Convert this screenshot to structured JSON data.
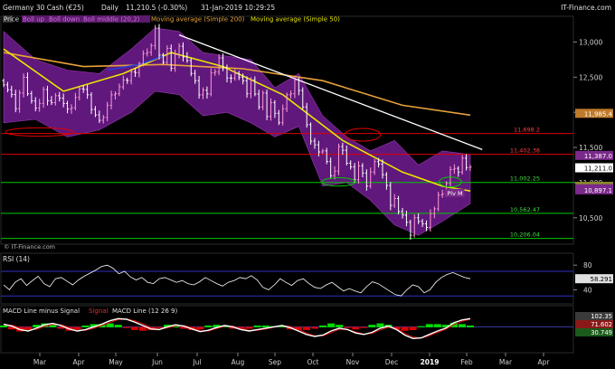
{
  "header": {
    "instrument": "Germany 30 Cash (€25)",
    "timeframe": "Daily",
    "quote": "11,210.5 (-0.30%)",
    "datetime": "31-Jan-2019 10:29:25",
    "brand": "IT-Finance.com"
  },
  "watermark": "© IT-Finance.com",
  "colors": {
    "bg": "#000000",
    "price_up": "#ff9ad5",
    "price_down": "#ffffff",
    "boll_fill": "#6a1b8a",
    "ma200": "#e8a23a",
    "ma50": "#e6e600",
    "ma_blue": "#2a3cd8",
    "trendline": "#ffffff",
    "resistance": "#e00000",
    "support": "#00cc00",
    "ellipse_red": "#e00000",
    "ellipse_green": "#00cc00",
    "rsi_line": "#ffffff",
    "rsi_band": "#3030c0",
    "macd_line": "#ffffff",
    "signal_line": "#e00000",
    "hist_pos": "#00dd00",
    "hist_neg": "#dd0000",
    "axis_text": "#cfcfcf"
  },
  "chart_data": [
    {
      "type": "candlestick",
      "panel": "price",
      "legend": [
        "Price",
        "Boll up",
        "Boll down",
        "Boll middle (20,2)",
        "Moving average (Simple 200)",
        "Moving average (Simple 50)"
      ],
      "xlabels": [
        "Mar",
        "Apr",
        "May",
        "Jun",
        "Jul",
        "Aug",
        "Sep",
        "Oct",
        "Nov",
        "Dec",
        "2019",
        "Feb",
        "Mar",
        "Apr"
      ],
      "ylim": [
        10150,
        13250
      ],
      "yticks": [
        10500,
        11000,
        11500,
        12000,
        12500,
        13000
      ],
      "ytick_labels": [
        "10,500",
        "11,000",
        "11,500",
        "12,000",
        "12,500",
        "13,000"
      ],
      "close_path": [
        [
          0,
          12450
        ],
        [
          3,
          12100
        ],
        [
          5,
          12450
        ],
        [
          8,
          12000
        ],
        [
          10,
          12300
        ],
        [
          12,
          12150
        ],
        [
          14,
          12250
        ],
        [
          16,
          12000
        ],
        [
          18,
          12200
        ],
        [
          20,
          12350
        ],
        [
          22,
          12100
        ],
        [
          24,
          11850
        ],
        [
          26,
          12100
        ],
        [
          28,
          12300
        ],
        [
          30,
          12400
        ],
        [
          32,
          12550
        ],
        [
          34,
          12700
        ],
        [
          36,
          12900
        ],
        [
          37,
          12950
        ],
        [
          38,
          13150
        ],
        [
          39,
          12850
        ],
        [
          40,
          12700
        ],
        [
          41,
          12850
        ],
        [
          42,
          12650
        ],
        [
          43,
          12800
        ],
        [
          44,
          13000
        ],
        [
          45,
          12800
        ],
        [
          46,
          12700
        ],
        [
          47,
          12600
        ],
        [
          48,
          12450
        ],
        [
          49,
          12200
        ],
        [
          50,
          12350
        ],
        [
          51,
          12250
        ],
        [
          52,
          12500
        ],
        [
          53,
          12600
        ],
        [
          54,
          12750
        ],
        [
          55,
          12700
        ],
        [
          56,
          12500
        ],
        [
          57,
          12450
        ],
        [
          58,
          12600
        ],
        [
          59,
          12500
        ],
        [
          60,
          12400
        ],
        [
          61,
          12300
        ],
        [
          62,
          12450
        ],
        [
          63,
          12200
        ],
        [
          64,
          12100
        ],
        [
          65,
          12250
        ],
        [
          66,
          12000
        ],
        [
          67,
          12150
        ],
        [
          68,
          11950
        ],
        [
          69,
          11900
        ],
        [
          70,
          12050
        ],
        [
          71,
          12200
        ],
        [
          72,
          12300
        ],
        [
          73,
          12450
        ],
        [
          74,
          12250
        ],
        [
          75,
          12100
        ],
        [
          76,
          11800
        ],
        [
          77,
          11650
        ],
        [
          78,
          11550
        ],
        [
          79,
          11400
        ],
        [
          80,
          11500
        ],
        [
          81,
          11300
        ],
        [
          82,
          11050
        ],
        [
          83,
          11200
        ],
        [
          84,
          11500
        ],
        [
          85,
          11400
        ],
        [
          86,
          11300
        ],
        [
          87,
          11200
        ],
        [
          88,
          11100
        ],
        [
          89,
          11250
        ],
        [
          90,
          11100
        ],
        [
          91,
          11000
        ],
        [
          92,
          11150
        ],
        [
          93,
          11250
        ],
        [
          94,
          11300
        ],
        [
          95,
          11100
        ],
        [
          96,
          10900
        ],
        [
          97,
          10700
        ],
        [
          98,
          10750
        ],
        [
          99,
          10650
        ],
        [
          100,
          10550
        ],
        [
          101,
          10400
        ],
        [
          102,
          10300
        ],
        [
          103,
          10500
        ],
        [
          104,
          10400
        ],
        [
          105,
          10450
        ],
        [
          106,
          10350
        ],
        [
          107,
          10500
        ],
        [
          108,
          10650
        ],
        [
          109,
          10800
        ],
        [
          110,
          10900
        ],
        [
          111,
          11000
        ],
        [
          112,
          11150
        ],
        [
          113,
          11250
        ],
        [
          114,
          11150
        ],
        [
          115,
          11300
        ],
        [
          116,
          11250
        ],
        [
          117,
          11210
        ]
      ],
      "ma200": [
        [
          0,
          12850
        ],
        [
          20,
          12650
        ],
        [
          40,
          12680
        ],
        [
          60,
          12620
        ],
        [
          80,
          12450
        ],
        [
          100,
          12100
        ],
        [
          117,
          11960
        ]
      ],
      "ma50": [
        [
          0,
          12900
        ],
        [
          15,
          12300
        ],
        [
          30,
          12550
        ],
        [
          42,
          12850
        ],
        [
          55,
          12650
        ],
        [
          70,
          12250
        ],
        [
          85,
          11600
        ],
        [
          100,
          11150
        ],
        [
          110,
          10950
        ],
        [
          117,
          10880
        ]
      ],
      "bollinger_up": [
        [
          0,
          13150
        ],
        [
          8,
          12750
        ],
        [
          16,
          12600
        ],
        [
          24,
          12550
        ],
        [
          32,
          12900
        ],
        [
          38,
          13200
        ],
        [
          44,
          13150
        ],
        [
          50,
          12850
        ],
        [
          56,
          12800
        ],
        [
          62,
          12750
        ],
        [
          68,
          12350
        ],
        [
          74,
          12550
        ],
        [
          80,
          11950
        ],
        [
          86,
          11650
        ],
        [
          92,
          11450
        ],
        [
          98,
          11600
        ],
        [
          104,
          11250
        ],
        [
          110,
          11450
        ],
        [
          117,
          11400
        ]
      ],
      "bollinger_down": [
        [
          0,
          11850
        ],
        [
          8,
          11900
        ],
        [
          16,
          11650
        ],
        [
          24,
          11750
        ],
        [
          32,
          12000
        ],
        [
          38,
          12300
        ],
        [
          44,
          12250
        ],
        [
          50,
          11950
        ],
        [
          56,
          12000
        ],
        [
          62,
          11850
        ],
        [
          68,
          11650
        ],
        [
          74,
          11800
        ],
        [
          80,
          10950
        ],
        [
          86,
          11000
        ],
        [
          92,
          10750
        ],
        [
          98,
          10400
        ],
        [
          104,
          10250
        ],
        [
          110,
          10450
        ],
        [
          117,
          10700
        ]
      ],
      "trendline": [
        [
          44,
          13100
        ],
        [
          120,
          11470
        ]
      ],
      "level_lines": [
        {
          "value": 11698.2,
          "label": "11,698.2",
          "color": "red"
        },
        {
          "value": 11402.38,
          "label": "11,402.38",
          "color": "red"
        },
        {
          "value": 11002.25,
          "label": "11,002.25",
          "color": "green"
        },
        {
          "value": 10562.47,
          "label": "10,562.47",
          "color": "green"
        },
        {
          "value": 10206.04,
          "label": "10,206.04",
          "color": "green"
        }
      ],
      "price_tags": [
        {
          "value": 11985.4,
          "label": "11,985.4",
          "fill": "#c07a2a"
        },
        {
          "value": 11387.0,
          "label": "11,387.0",
          "fill": "#7a2a8a"
        },
        {
          "value": 11211.0,
          "label": "11,211.0",
          "fill": "#ffffff",
          "text": "#000000"
        },
        {
          "value": 10946.9,
          "label": "10,946.9",
          "fill": "#8a8a2a"
        },
        {
          "value": 10913.0,
          "label": "10,913.0",
          "fill": "#7a2a8a"
        },
        {
          "value": 10897.1,
          "label": "10,897.1",
          "fill": "#7a2a8a"
        }
      ],
      "ellipses": [
        {
          "cx": 9,
          "cy": 11720,
          "rx": 8.5,
          "ry": 60,
          "color": "red"
        },
        {
          "cx": 90,
          "cy": 11680,
          "rx": 4.5,
          "ry": 90,
          "color": "red"
        },
        {
          "cx": 84,
          "cy": 11010,
          "rx": 4.2,
          "ry": 60,
          "color": "green"
        },
        {
          "cx": 112,
          "cy": 11010,
          "rx": 2.8,
          "ry": 70,
          "color": "green"
        }
      ],
      "pivot_label": "Piv M"
    },
    {
      "type": "line",
      "panel": "rsi",
      "legend": [
        "RSI (14)"
      ],
      "ylim": [
        20,
        95
      ],
      "yticks": [
        40,
        80
      ],
      "band": [
        30,
        70
      ],
      "last_label": "58.291",
      "values": [
        48,
        40,
        52,
        58,
        47,
        55,
        62,
        50,
        45,
        58,
        60,
        54,
        48,
        56,
        62,
        67,
        72,
        78,
        80,
        75,
        66,
        70,
        61,
        56,
        60,
        52,
        50,
        58,
        60,
        56,
        52,
        55,
        50,
        48,
        53,
        60,
        55,
        50,
        46,
        52,
        55,
        60,
        58,
        63,
        56,
        44,
        40,
        48,
        58,
        52,
        47,
        55,
        58,
        50,
        44,
        42,
        48,
        52,
        45,
        38,
        42,
        38,
        35,
        45,
        53,
        50,
        44,
        38,
        32,
        30,
        40,
        48,
        45,
        35,
        40,
        52,
        60,
        65,
        68,
        64,
        60,
        58
      ]
    },
    {
      "type": "line",
      "panel": "macd",
      "legend": [
        "MACD Line minus Signal",
        "Signal",
        "MACD Line (12 26 9)"
      ],
      "ylim": [
        -350,
        150
      ],
      "tags": [
        {
          "value": 102.35,
          "label": "102.35",
          "fill": "#3a3a3a"
        },
        {
          "value": 71.602,
          "label": "71.602",
          "fill": "#8a1a1a"
        },
        {
          "value": 30.749,
          "label": "30.749",
          "fill": "#1a5a1a"
        }
      ],
      "macd": [
        40,
        10,
        -40,
        -60,
        -20,
        30,
        50,
        20,
        -30,
        -60,
        -40,
        0,
        40,
        90,
        120,
        110,
        70,
        20,
        -30,
        -40,
        0,
        30,
        10,
        -30,
        -70,
        -50,
        -10,
        20,
        0,
        -40,
        -60,
        -40,
        -20,
        0,
        20,
        -10,
        -60,
        -110,
        -140,
        -120,
        -60,
        -20,
        -40,
        -90,
        -110,
        -80,
        -20,
        10,
        -40,
        -120,
        -170,
        -160,
        -110,
        -60,
        -20,
        60,
        100,
        120
      ],
      "signal": [
        30,
        25,
        -10,
        -45,
        -35,
        5,
        35,
        30,
        -5,
        -45,
        -50,
        -20,
        20,
        65,
        105,
        115,
        90,
        45,
        -10,
        -35,
        -15,
        15,
        20,
        -10,
        -55,
        -60,
        -25,
        10,
        10,
        -25,
        -50,
        -50,
        -30,
        -5,
        15,
        5,
        -40,
        -90,
        -130,
        -130,
        -85,
        -35,
        -35,
        -75,
        -105,
        -95,
        -45,
        -5,
        -25,
        -95,
        -150,
        -165,
        -130,
        -80,
        -35,
        30,
        80,
        110
      ]
    }
  ]
}
